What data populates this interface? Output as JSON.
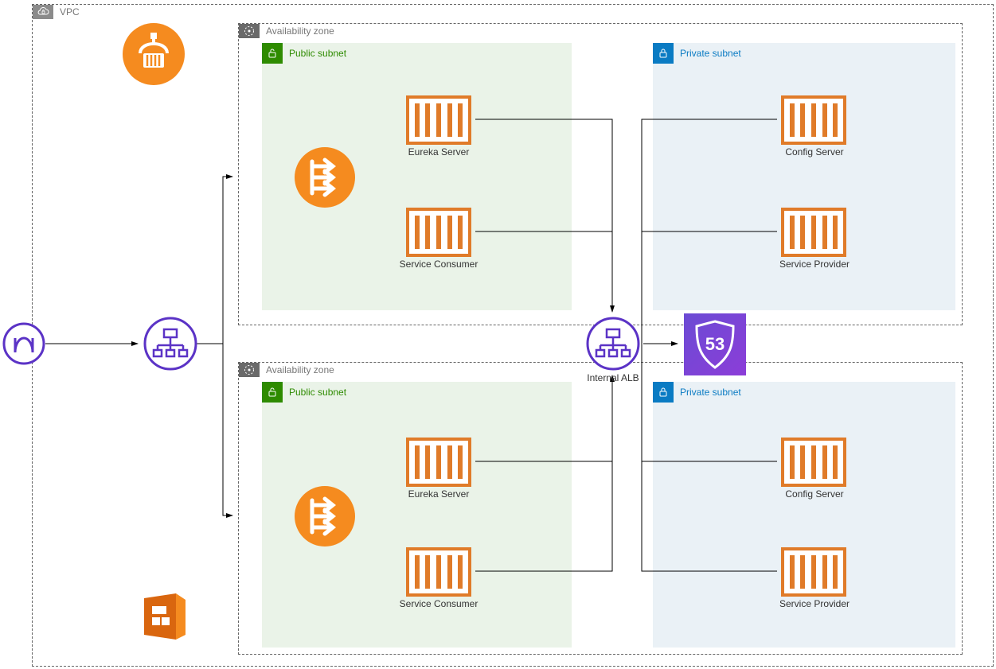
{
  "vpc": {
    "label": "VPC"
  },
  "az1": {
    "label": "Availability zone"
  },
  "az2": {
    "label": "Availability zone"
  },
  "public_subnet1": {
    "label": "Public subnet"
  },
  "public_subnet2": {
    "label": "Public subnet"
  },
  "private_subnet1": {
    "label": "Private subnet"
  },
  "private_subnet2": {
    "label": "Private subnet"
  },
  "nodes": {
    "eureka1": "Eureka Server",
    "consumer1": "Service Consumer",
    "config1": "Config Server",
    "provider1": "Service Provider",
    "eureka2": "Eureka Server",
    "consumer2": "Service Consumer",
    "config2": "Config Server",
    "provider2": "Service Provider",
    "internal_alb": "Internal ALB",
    "route53_badge": "53"
  }
}
